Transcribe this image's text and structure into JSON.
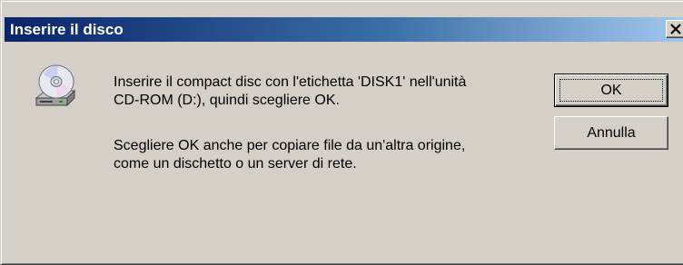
{
  "dialog": {
    "title": "Inserire il disco",
    "message_line1": "Inserire il compact disc con l'etichetta 'DISK1' nell'unità",
    "message_line2": "CD-ROM (D:), quindi scegliere OK.",
    "message_line3": "Scegliere OK anche per copiare file da un'altra origine,",
    "message_line4": "come un dischetto o un server di rete.",
    "ok_label": "OK",
    "cancel_label": "Annulla",
    "icon": "cd-drive-icon",
    "close_icon": "close-icon"
  },
  "colors": {
    "title_start": "#0a246a",
    "title_end": "#a6caf0",
    "face": "#d4d0c8"
  }
}
